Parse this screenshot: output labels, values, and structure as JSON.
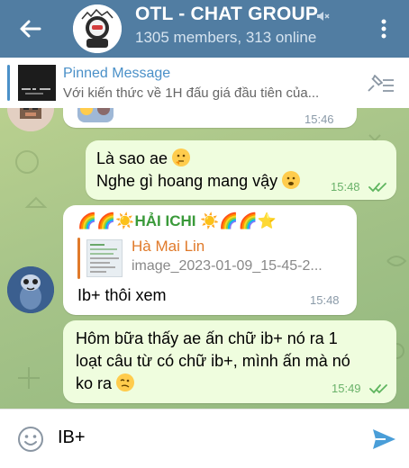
{
  "header": {
    "title": "OTL - CHAT GROUP",
    "subtitle": "1305 members, 313 online",
    "accent": "#517da2"
  },
  "pinned": {
    "title": "Pinned Message",
    "text": "Với kiến thức về 1H đấu giá đầu tiên của..."
  },
  "messages": [
    {
      "time": "15:46"
    },
    {
      "lines": [
        "Là sao ae",
        "Nghe gì hoang mang vậy"
      ],
      "time": "15:48",
      "read": true
    },
    {
      "sender": "🌈🌈☀️HẢI ICHI ☀️🌈🌈⭐",
      "reply_name": "Hà Mai Lin",
      "reply_text": "image_2023-01-09_15-45-2...",
      "text": "Ib+ thôi xem",
      "time": "15:48"
    },
    {
      "lines": [
        "Hôm bữa thấy ae ấn chữ ib+ nó ra 1",
        "loạt câu từ có chữ ib+, mình ấn mà nó",
        "ko ra"
      ],
      "time": "15:49",
      "read": true
    }
  ],
  "input": {
    "value": "IB+"
  },
  "icons": {
    "back": "back-arrow-icon",
    "mute": "mute-icon",
    "menu": "more-vertical-icon",
    "pin": "unpin-list-icon",
    "emoji": "emoji-icon",
    "send": "send-icon"
  }
}
